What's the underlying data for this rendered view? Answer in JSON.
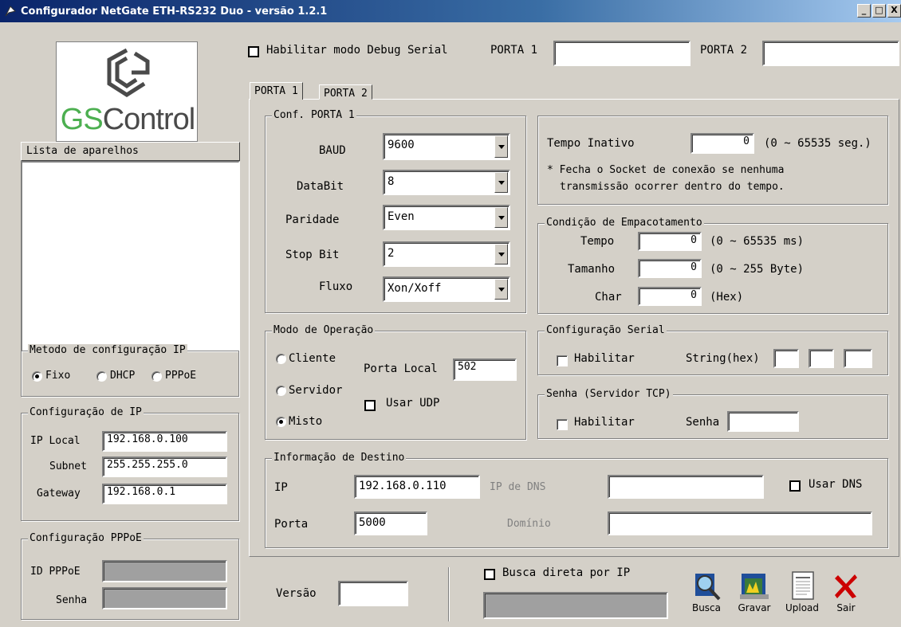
{
  "window": {
    "title": "Configurador NetGate ETH-RS232 Duo - versão 1.2.1",
    "btn_min": "_",
    "btn_max": "□",
    "btn_close": "X"
  },
  "logo": {
    "text_gs": "GS",
    "text_control": "Control"
  },
  "debug": {
    "label": "Habilitar modo Debug Serial",
    "porta1_label": "PORTA 1",
    "porta1_value": "",
    "porta2_label": "PORTA 2",
    "porta2_value": ""
  },
  "device_list": {
    "header": "Lista de aparelhos",
    "items": []
  },
  "ip_method": {
    "legend": "Metodo de configuração IP",
    "options": [
      "Fixo",
      "DHCP",
      "PPPoE"
    ],
    "selected": "Fixo"
  },
  "ip_config": {
    "legend": "Configuração de IP",
    "ip_local_label": "IP Local",
    "ip_local": "192.168.0.100",
    "subnet_label": "Subnet",
    "subnet": "255.255.255.0",
    "gateway_label": "Gateway",
    "gateway": "192.168.0.1"
  },
  "pppoe": {
    "legend": "Configuração PPPoE",
    "id_label": "ID PPPoE",
    "id_value": "",
    "senha_label": "Senha",
    "senha_value": ""
  },
  "tabs": [
    {
      "label": "PORTA 1"
    },
    {
      "label": "PORTA 2"
    }
  ],
  "conf_porta": {
    "legend": "Conf. PORTA 1",
    "baud_label": "BAUD",
    "baud": "9600",
    "databit_label": "DataBit",
    "databit": "8",
    "paridade_label": "Paridade",
    "paridade": "Even",
    "stopbit_label": "Stop Bit",
    "stopbit": "2",
    "fluxo_label": "Fluxo",
    "fluxo": "Xon/Xoff"
  },
  "inactive": {
    "label": "Tempo Inativo",
    "value": "0",
    "range": "(0 ~ 65535 seg.)",
    "note1": "* Fecha o Socket de conexão se nenhuma",
    "note2": "transmissão ocorrer dentro do tempo."
  },
  "packing": {
    "legend": "Condição de Empacotamento",
    "tempo_label": "Tempo",
    "tempo": "0",
    "tempo_range": "(0 ~ 65535 ms)",
    "tamanho_label": "Tamanho",
    "tamanho": "0",
    "tamanho_range": "(0 ~ 255 Byte)",
    "char_label": "Char",
    "char": "0",
    "char_range": "(Hex)"
  },
  "op_mode": {
    "legend": "Modo de Operação",
    "options": [
      "Cliente",
      "Servidor",
      "Misto"
    ],
    "selected": "Misto",
    "porta_local_label": "Porta Local",
    "porta_local": "502",
    "udp_label": "Usar UDP"
  },
  "serial_config": {
    "legend": "Configuração Serial",
    "habilitar": "Habilitar",
    "string_label": "String(hex)",
    "hex1": "",
    "hex2": "",
    "hex3": ""
  },
  "tcp_password": {
    "legend": "Senha (Servidor TCP)",
    "habilitar": "Habilitar",
    "senha_label": "Senha",
    "senha_value": ""
  },
  "destination": {
    "legend": "Informação de Destino",
    "ip_label": "IP",
    "ip": "192.168.0.110",
    "dns_label": "IP de DNS",
    "dns": "",
    "use_dns": "Usar DNS",
    "porta_label": "Porta",
    "porta": "5000",
    "dominio_label": "Domínio",
    "dominio": ""
  },
  "footer": {
    "versao_label": "Versão",
    "versao_value": "",
    "busca_direta": "Busca direta por IP",
    "busca_ip_value": "",
    "buttons": [
      {
        "label": "Busca",
        "icon": "magnifier-icon"
      },
      {
        "label": "Gravar",
        "icon": "write-device-icon"
      },
      {
        "label": "Upload",
        "icon": "upload-document-icon"
      },
      {
        "label": "Sair",
        "icon": "red-x-icon"
      }
    ]
  },
  "colors": {
    "window_bg": "#d4d0c8",
    "title_start": "#0a246a",
    "title_end": "#a6caf0",
    "logo_gray": "#4a4a4a",
    "logo_green": "#4caf50",
    "exit_red": "#cc0000",
    "disabled_field": "#a0a0a0"
  }
}
